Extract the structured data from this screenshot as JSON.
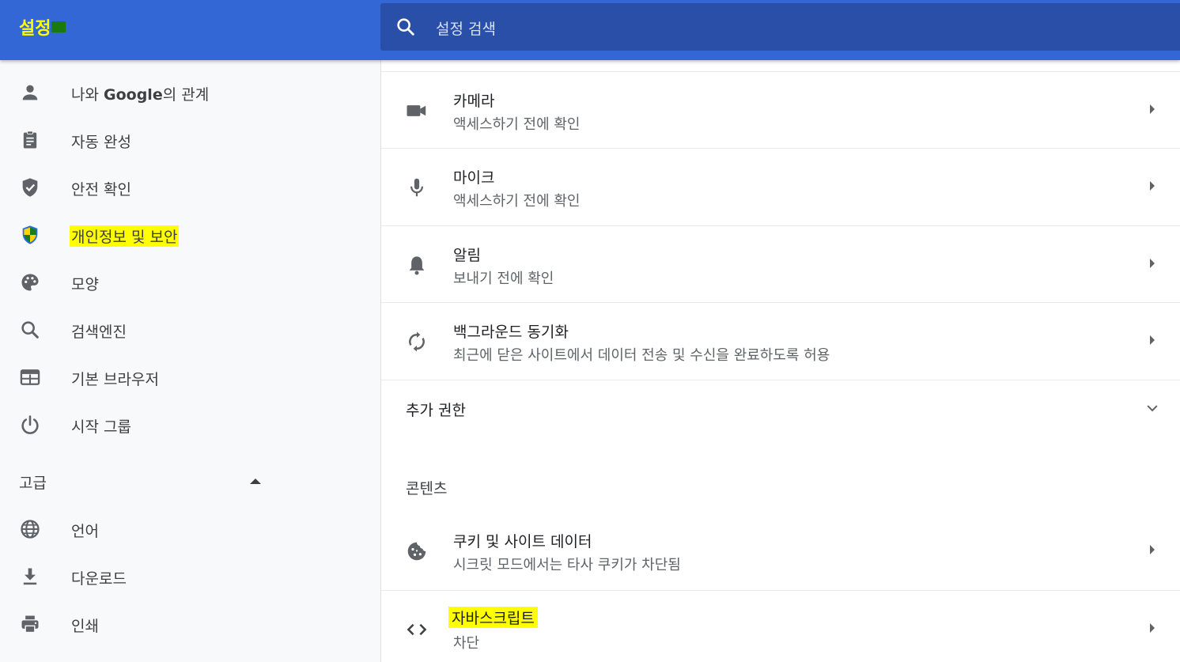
{
  "header": {
    "title": "설정",
    "search_placeholder": "설정 검색"
  },
  "sidebar": {
    "items": [
      {
        "label_pre": "나와 ",
        "label_bold": "Google",
        "label_post": "의 관계",
        "icon": "person-icon"
      },
      {
        "label": "자동 완성",
        "icon": "clipboard-icon"
      },
      {
        "label": "안전 확인",
        "icon": "shield-check-icon"
      },
      {
        "label": "개인정보 및 보안",
        "icon": "shield-privacy-icon",
        "highlighted": true
      },
      {
        "label": "모양",
        "icon": "palette-icon"
      },
      {
        "label": "검색엔진",
        "icon": "search-icon"
      },
      {
        "label": "기본 브라우저",
        "icon": "browser-icon"
      },
      {
        "label": "시작 그룹",
        "icon": "power-icon"
      }
    ],
    "advanced_label": "고급",
    "advanced_items": [
      {
        "label": "언어",
        "icon": "globe-icon"
      },
      {
        "label": "다운로드",
        "icon": "download-icon"
      },
      {
        "label": "인쇄",
        "icon": "printer-icon"
      }
    ]
  },
  "main": {
    "rows": [
      {
        "title": "카메라",
        "subtitle": "액세스하기 전에 확인",
        "icon": "camera-icon"
      },
      {
        "title": "마이크",
        "subtitle": "액세스하기 전에 확인",
        "icon": "microphone-icon"
      },
      {
        "title": "알림",
        "subtitle": "보내기 전에 확인",
        "icon": "bell-icon"
      },
      {
        "title": "백그라운드 동기화",
        "subtitle": "최근에 닫은 사이트에서 데이터 전송 및 수신을 완료하도록 허용",
        "icon": "sync-icon"
      }
    ],
    "extra_permissions_label": "추가 권한",
    "content_section_label": "콘텐츠",
    "content_rows": [
      {
        "title": "쿠키 및 사이트 데이터",
        "subtitle": "시크릿 모드에서는 타사 쿠키가 차단됨",
        "icon": "cookie-icon"
      },
      {
        "title": "자바스크립트",
        "subtitle": "차단",
        "icon": "code-icon",
        "highlighted": true
      }
    ]
  },
  "colors": {
    "header_bg": "#3367d6",
    "search_bg": "#2a4fa8",
    "highlight": "#ffff00",
    "title_text": "#ffff00"
  }
}
